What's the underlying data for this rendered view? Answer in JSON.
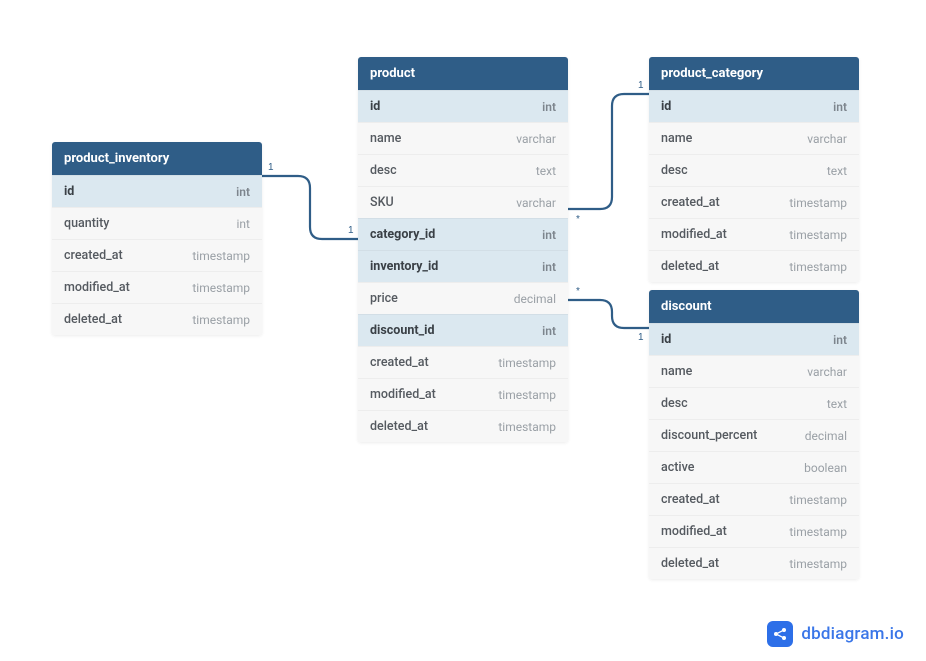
{
  "tables": {
    "product_inventory": {
      "title": "product_inventory",
      "columns": [
        {
          "name": "id",
          "type": "int",
          "hl": true
        },
        {
          "name": "quantity",
          "type": "int",
          "hl": false
        },
        {
          "name": "created_at",
          "type": "timestamp",
          "hl": false
        },
        {
          "name": "modified_at",
          "type": "timestamp",
          "hl": false
        },
        {
          "name": "deleted_at",
          "type": "timestamp",
          "hl": false
        }
      ]
    },
    "product": {
      "title": "product",
      "columns": [
        {
          "name": "id",
          "type": "int",
          "hl": true
        },
        {
          "name": "name",
          "type": "varchar",
          "hl": false
        },
        {
          "name": "desc",
          "type": "text",
          "hl": false
        },
        {
          "name": "SKU",
          "type": "varchar",
          "hl": false
        },
        {
          "name": "category_id",
          "type": "int",
          "hl": true
        },
        {
          "name": "inventory_id",
          "type": "int",
          "hl": true
        },
        {
          "name": "price",
          "type": "decimal",
          "hl": false
        },
        {
          "name": "discount_id",
          "type": "int",
          "hl": true
        },
        {
          "name": "created_at",
          "type": "timestamp",
          "hl": false
        },
        {
          "name": "modified_at",
          "type": "timestamp",
          "hl": false
        },
        {
          "name": "deleted_at",
          "type": "timestamp",
          "hl": false
        }
      ]
    },
    "product_category": {
      "title": "product_category",
      "columns": [
        {
          "name": "id",
          "type": "int",
          "hl": true
        },
        {
          "name": "name",
          "type": "varchar",
          "hl": false
        },
        {
          "name": "desc",
          "type": "text",
          "hl": false
        },
        {
          "name": "created_at",
          "type": "timestamp",
          "hl": false
        },
        {
          "name": "modified_at",
          "type": "timestamp",
          "hl": false
        },
        {
          "name": "deleted_at",
          "type": "timestamp",
          "hl": false
        }
      ]
    },
    "discount": {
      "title": "discount",
      "columns": [
        {
          "name": "id",
          "type": "int",
          "hl": true
        },
        {
          "name": "name",
          "type": "varchar",
          "hl": false
        },
        {
          "name": "desc",
          "type": "text",
          "hl": false
        },
        {
          "name": "discount_percent",
          "type": "decimal",
          "hl": false
        },
        {
          "name": "active",
          "type": "boolean",
          "hl": false
        },
        {
          "name": "created_at",
          "type": "timestamp",
          "hl": false
        },
        {
          "name": "modified_at",
          "type": "timestamp",
          "hl": false
        },
        {
          "name": "deleted_at",
          "type": "timestamp",
          "hl": false
        }
      ]
    }
  },
  "relations": [
    {
      "from": "product.inventory_id",
      "from_card": "1",
      "to": "product_inventory.id",
      "to_card": "1"
    },
    {
      "from": "product.category_id",
      "from_card": "*",
      "to": "product_category.id",
      "to_card": "1"
    },
    {
      "from": "product.discount_id",
      "from_card": "*",
      "to": "discount.id",
      "to_card": "1"
    }
  ],
  "branding": {
    "text": "dbdiagram.io"
  }
}
